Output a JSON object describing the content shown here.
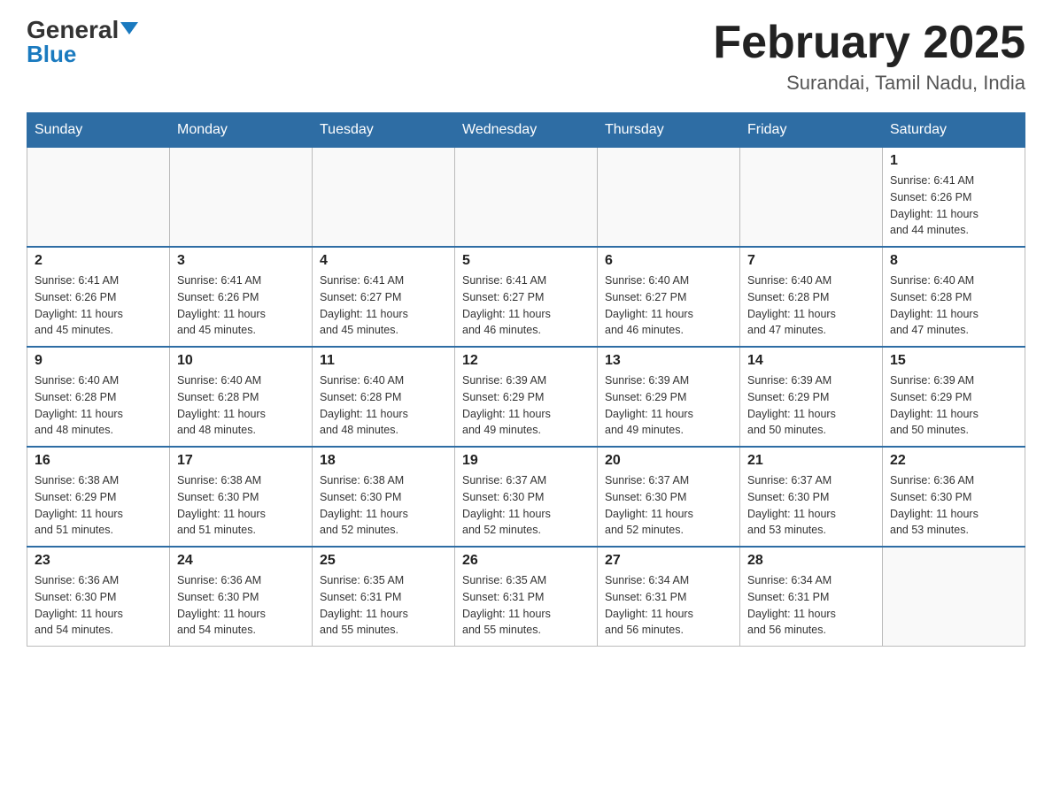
{
  "logo": {
    "general": "General",
    "blue": "Blue"
  },
  "header": {
    "month": "February 2025",
    "location": "Surandai, Tamil Nadu, India"
  },
  "weekdays": [
    "Sunday",
    "Monday",
    "Tuesday",
    "Wednesday",
    "Thursday",
    "Friday",
    "Saturday"
  ],
  "weeks": [
    [
      {
        "day": "",
        "info": ""
      },
      {
        "day": "",
        "info": ""
      },
      {
        "day": "",
        "info": ""
      },
      {
        "day": "",
        "info": ""
      },
      {
        "day": "",
        "info": ""
      },
      {
        "day": "",
        "info": ""
      },
      {
        "day": "1",
        "info": "Sunrise: 6:41 AM\nSunset: 6:26 PM\nDaylight: 11 hours\nand 44 minutes."
      }
    ],
    [
      {
        "day": "2",
        "info": "Sunrise: 6:41 AM\nSunset: 6:26 PM\nDaylight: 11 hours\nand 45 minutes."
      },
      {
        "day": "3",
        "info": "Sunrise: 6:41 AM\nSunset: 6:26 PM\nDaylight: 11 hours\nand 45 minutes."
      },
      {
        "day": "4",
        "info": "Sunrise: 6:41 AM\nSunset: 6:27 PM\nDaylight: 11 hours\nand 45 minutes."
      },
      {
        "day": "5",
        "info": "Sunrise: 6:41 AM\nSunset: 6:27 PM\nDaylight: 11 hours\nand 46 minutes."
      },
      {
        "day": "6",
        "info": "Sunrise: 6:40 AM\nSunset: 6:27 PM\nDaylight: 11 hours\nand 46 minutes."
      },
      {
        "day": "7",
        "info": "Sunrise: 6:40 AM\nSunset: 6:28 PM\nDaylight: 11 hours\nand 47 minutes."
      },
      {
        "day": "8",
        "info": "Sunrise: 6:40 AM\nSunset: 6:28 PM\nDaylight: 11 hours\nand 47 minutes."
      }
    ],
    [
      {
        "day": "9",
        "info": "Sunrise: 6:40 AM\nSunset: 6:28 PM\nDaylight: 11 hours\nand 48 minutes."
      },
      {
        "day": "10",
        "info": "Sunrise: 6:40 AM\nSunset: 6:28 PM\nDaylight: 11 hours\nand 48 minutes."
      },
      {
        "day": "11",
        "info": "Sunrise: 6:40 AM\nSunset: 6:28 PM\nDaylight: 11 hours\nand 48 minutes."
      },
      {
        "day": "12",
        "info": "Sunrise: 6:39 AM\nSunset: 6:29 PM\nDaylight: 11 hours\nand 49 minutes."
      },
      {
        "day": "13",
        "info": "Sunrise: 6:39 AM\nSunset: 6:29 PM\nDaylight: 11 hours\nand 49 minutes."
      },
      {
        "day": "14",
        "info": "Sunrise: 6:39 AM\nSunset: 6:29 PM\nDaylight: 11 hours\nand 50 minutes."
      },
      {
        "day": "15",
        "info": "Sunrise: 6:39 AM\nSunset: 6:29 PM\nDaylight: 11 hours\nand 50 minutes."
      }
    ],
    [
      {
        "day": "16",
        "info": "Sunrise: 6:38 AM\nSunset: 6:29 PM\nDaylight: 11 hours\nand 51 minutes."
      },
      {
        "day": "17",
        "info": "Sunrise: 6:38 AM\nSunset: 6:30 PM\nDaylight: 11 hours\nand 51 minutes."
      },
      {
        "day": "18",
        "info": "Sunrise: 6:38 AM\nSunset: 6:30 PM\nDaylight: 11 hours\nand 52 minutes."
      },
      {
        "day": "19",
        "info": "Sunrise: 6:37 AM\nSunset: 6:30 PM\nDaylight: 11 hours\nand 52 minutes."
      },
      {
        "day": "20",
        "info": "Sunrise: 6:37 AM\nSunset: 6:30 PM\nDaylight: 11 hours\nand 52 minutes."
      },
      {
        "day": "21",
        "info": "Sunrise: 6:37 AM\nSunset: 6:30 PM\nDaylight: 11 hours\nand 53 minutes."
      },
      {
        "day": "22",
        "info": "Sunrise: 6:36 AM\nSunset: 6:30 PM\nDaylight: 11 hours\nand 53 minutes."
      }
    ],
    [
      {
        "day": "23",
        "info": "Sunrise: 6:36 AM\nSunset: 6:30 PM\nDaylight: 11 hours\nand 54 minutes."
      },
      {
        "day": "24",
        "info": "Sunrise: 6:36 AM\nSunset: 6:30 PM\nDaylight: 11 hours\nand 54 minutes."
      },
      {
        "day": "25",
        "info": "Sunrise: 6:35 AM\nSunset: 6:31 PM\nDaylight: 11 hours\nand 55 minutes."
      },
      {
        "day": "26",
        "info": "Sunrise: 6:35 AM\nSunset: 6:31 PM\nDaylight: 11 hours\nand 55 minutes."
      },
      {
        "day": "27",
        "info": "Sunrise: 6:34 AM\nSunset: 6:31 PM\nDaylight: 11 hours\nand 56 minutes."
      },
      {
        "day": "28",
        "info": "Sunrise: 6:34 AM\nSunset: 6:31 PM\nDaylight: 11 hours\nand 56 minutes."
      },
      {
        "day": "",
        "info": ""
      }
    ]
  ]
}
